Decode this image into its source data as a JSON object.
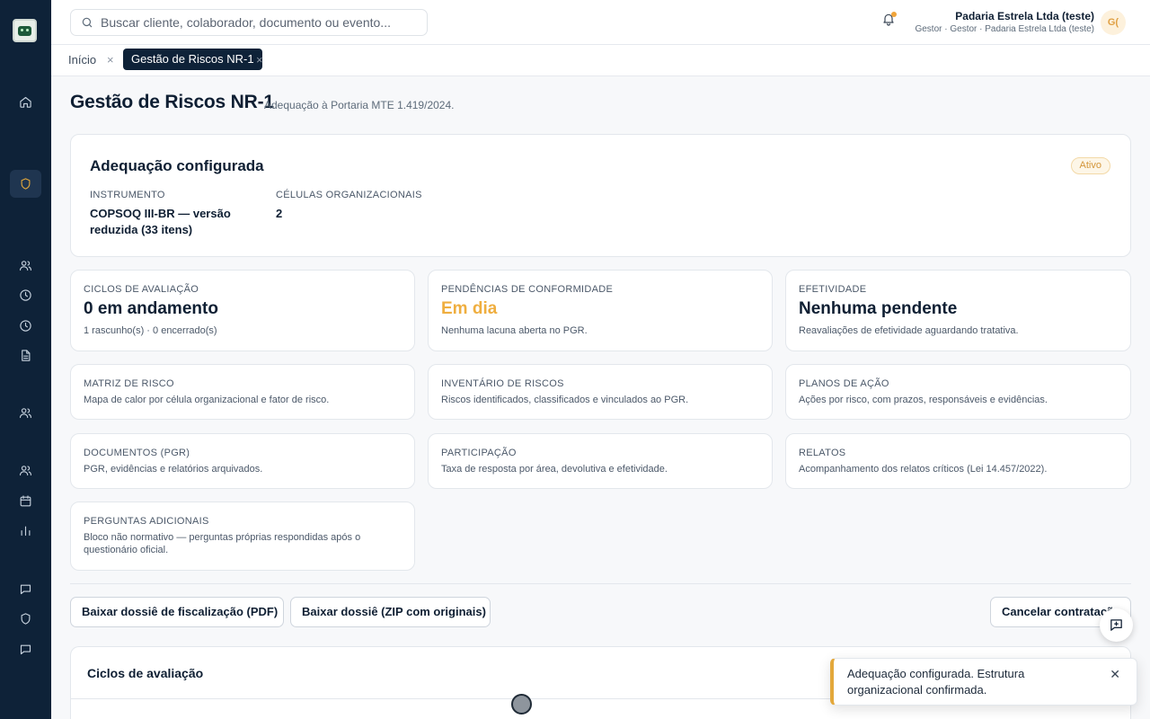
{
  "topbar": {
    "search_placeholder": "Buscar cliente, colaborador, documento ou evento...",
    "user_name": "Padaria Estrela Ltda (teste)",
    "user_role": "Gestor · Gestor · Padaria Estrela Ltda (teste)",
    "avatar_initials": "G("
  },
  "tabs": {
    "home": "Início",
    "active": "Gestão de Riscos NR-1",
    "close_glyph": "×"
  },
  "page": {
    "title": "Gestão de Riscos NR-1",
    "subtitle": "Adequação à Portaria MTE 1.419/2024."
  },
  "summary": {
    "title": "Adequação configurada",
    "status": "Ativo",
    "instrument_label": "Instrumento",
    "instrument_value": "COPSOQ III-BR — versão reduzida (33 itens)",
    "cells_label": "Células organizacionais",
    "cells_value": "2"
  },
  "stats": [
    {
      "label": "Ciclos de avaliação",
      "value": "0 em andamento",
      "note": "1 rascunho(s) · 0 encerrado(s)"
    },
    {
      "label": "Pendências de conformidade",
      "value": "Em dia",
      "note": "Nenhuma lacuna aberta no PGR."
    },
    {
      "label": "Efetividade",
      "value": "Nenhuma pendente",
      "note": "Reavaliações de efetividade aguardando tratativa."
    }
  ],
  "modules": [
    {
      "label": "Matriz de risco",
      "desc": "Mapa de calor por célula organizacional e fator de risco."
    },
    {
      "label": "Inventário de riscos",
      "desc": "Riscos identificados, classificados e vinculados ao PGR."
    },
    {
      "label": "Planos de ação",
      "desc": "Ações por risco, com prazos, responsáveis e evidências."
    },
    {
      "label": "Documentos (PGR)",
      "desc": "PGR, evidências e relatórios arquivados."
    },
    {
      "label": "Participação",
      "desc": "Taxa de resposta por área, devolutiva e efetividade."
    },
    {
      "label": "Relatos",
      "desc": "Acompanhamento dos relatos críticos (Lei 14.457/2022)."
    },
    {
      "label": "Perguntas adicionais",
      "desc": "Bloco não normativo — perguntas próprias respondidas após o questionário oficial."
    }
  ],
  "actions": {
    "dossier_pdf": "Baixar dossiê de fiscalização (PDF)",
    "dossier_zip": "Baixar dossiê (ZIP com originais)",
    "cancel": "Cancelar contratação"
  },
  "cycles": {
    "title": "Ciclos de avaliação"
  },
  "toast": {
    "message": "Adequação configurada. Estrutura organizacional confirmada.",
    "close_glyph": "✕"
  },
  "colors": {
    "sidebar_bg": "#0e2238",
    "accent": "#e3a83b",
    "ok_text": "#efae3f"
  },
  "icons": {
    "sidebar": [
      "home-icon",
      "shield-icon",
      "users-icon",
      "clock-icon",
      "clock-icon",
      "document-icon",
      "users-icon",
      "users-icon",
      "calendar-icon",
      "bar-chart-icon",
      "chat-icon",
      "shield-icon",
      "chat-icon"
    ]
  }
}
